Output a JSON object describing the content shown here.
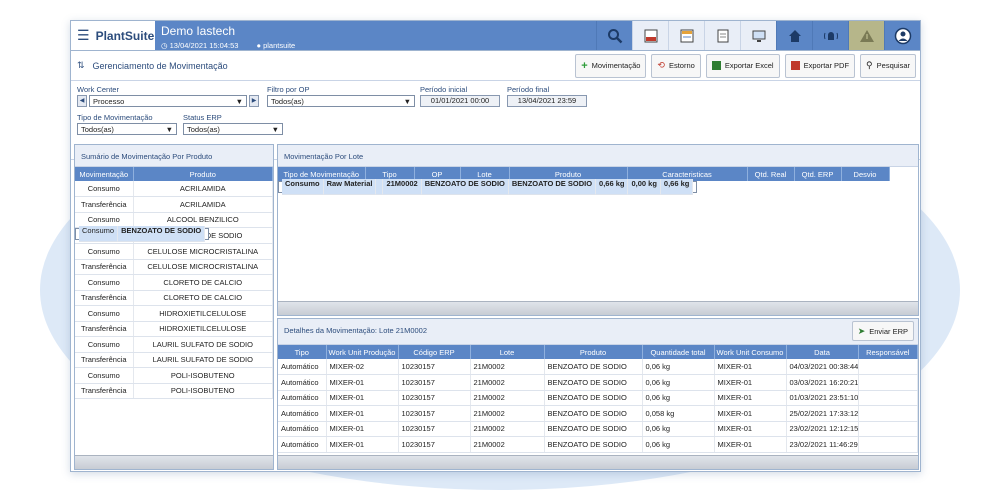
{
  "app": {
    "brand": "PlantSuite",
    "title": "Demo Iastech",
    "datetime": "13/04/2021 15:04:53",
    "user": "plantsuite"
  },
  "page": {
    "title": "Gerenciamento de Movimentação",
    "actions": [
      "Movimentação",
      "Estorno",
      "Exportar Excel",
      "Exportar PDF",
      "Pesquisar"
    ]
  },
  "filters": {
    "work_center_label": "Work Center",
    "work_center_value": "Processo",
    "op_label": "Filtro por OP",
    "op_value": "Todos(as)",
    "start_label": "Período inicial",
    "start_value": "01/01/2021 00:00",
    "end_label": "Período final",
    "end_value": "13/04/2021 23:59",
    "tipo_label": "Tipo de Movimentação",
    "tipo_value": "Todos(as)",
    "erp_label": "Status ERP",
    "erp_value": "Todos(as)"
  },
  "summary": {
    "title": "Sumário de Movimentação Por Produto",
    "columns": [
      "Movimentação",
      "Produto"
    ],
    "rows": [
      [
        "Consumo",
        "ACRILAMIDA"
      ],
      [
        "Transferência",
        "ACRILAMIDA"
      ],
      [
        "Consumo",
        "ALCOOL BENZILICO"
      ],
      [
        "Consumo",
        "BENZOATO DE SODIO"
      ],
      [
        "Transferência",
        "BENZOATO DE SODIO"
      ],
      [
        "Consumo",
        "CELULOSE MICROCRISTALINA"
      ],
      [
        "Transferência",
        "CELULOSE MICROCRISTALINA"
      ],
      [
        "Consumo",
        "CLORETO DE CALCIO"
      ],
      [
        "Transferência",
        "CLORETO DE CALCIO"
      ],
      [
        "Consumo",
        "HIDROXIETILCELULOSE"
      ],
      [
        "Transferência",
        "HIDROXIETILCELULOSE"
      ],
      [
        "Consumo",
        "LAURIL SULFATO DE SODIO"
      ],
      [
        "Transferência",
        "LAURIL SULFATO DE SODIO"
      ],
      [
        "Consumo",
        "POLI-ISOBUTENO"
      ],
      [
        "Transferência",
        "POLI-ISOBUTENO"
      ]
    ],
    "selected": 3
  },
  "lote": {
    "title": "Movimentação Por Lote",
    "columns": [
      "Tipo de Movimentação",
      "Tipo",
      "OP",
      "Lote",
      "Produto",
      "Caracteristicas",
      "Qtd. Real",
      "Qtd. ERP",
      "Desvio"
    ],
    "rows": [
      [
        "Consumo",
        "Raw Material",
        "",
        "21M0002",
        "BENZOATO DE SODIO",
        "BENZOATO DE SODIO",
        "0,66 kg",
        "0,00 kg",
        "0,66 kg"
      ]
    ]
  },
  "details": {
    "title": "Detalhes da Movimentação: Lote 21M0002",
    "send_label": "Enviar ERP",
    "columns": [
      "Tipo",
      "Work Unit Produção",
      "Código ERP",
      "Lote",
      "Produto",
      "Quantidade total",
      "Work Unit Consumo",
      "Data",
      "Responsável"
    ],
    "rows": [
      [
        "Automático",
        "MIXER-02",
        "10230157",
        "21M0002",
        "BENZOATO DE SODIO",
        "0,06 kg",
        "MIXER-01",
        "04/03/2021 00:38:44",
        ""
      ],
      [
        "Automático",
        "MIXER-01",
        "10230157",
        "21M0002",
        "BENZOATO DE SODIO",
        "0,06 kg",
        "MIXER-01",
        "03/03/2021 16:20:21",
        ""
      ],
      [
        "Automático",
        "MIXER-01",
        "10230157",
        "21M0002",
        "BENZOATO DE SODIO",
        "0,06 kg",
        "MIXER-01",
        "01/03/2021 23:51:10",
        ""
      ],
      [
        "Automático",
        "MIXER-01",
        "10230157",
        "21M0002",
        "BENZOATO DE SODIO",
        "0,058 kg",
        "MIXER-01",
        "25/02/2021 17:33:12",
        ""
      ],
      [
        "Automático",
        "MIXER-01",
        "10230157",
        "21M0002",
        "BENZOATO DE SODIO",
        "0,06 kg",
        "MIXER-01",
        "23/02/2021 12:12:15",
        ""
      ],
      [
        "Automático",
        "MIXER-01",
        "10230157",
        "21M0002",
        "BENZOATO DE SODIO",
        "0,06 kg",
        "MIXER-01",
        "23/02/2021 11:46:29",
        ""
      ]
    ]
  },
  "colors": {
    "header_blue": "#5b86c6",
    "panel_bg": "#e9eef7",
    "selected_row": "#cfe0f6",
    "olive": "#b6b68a"
  }
}
